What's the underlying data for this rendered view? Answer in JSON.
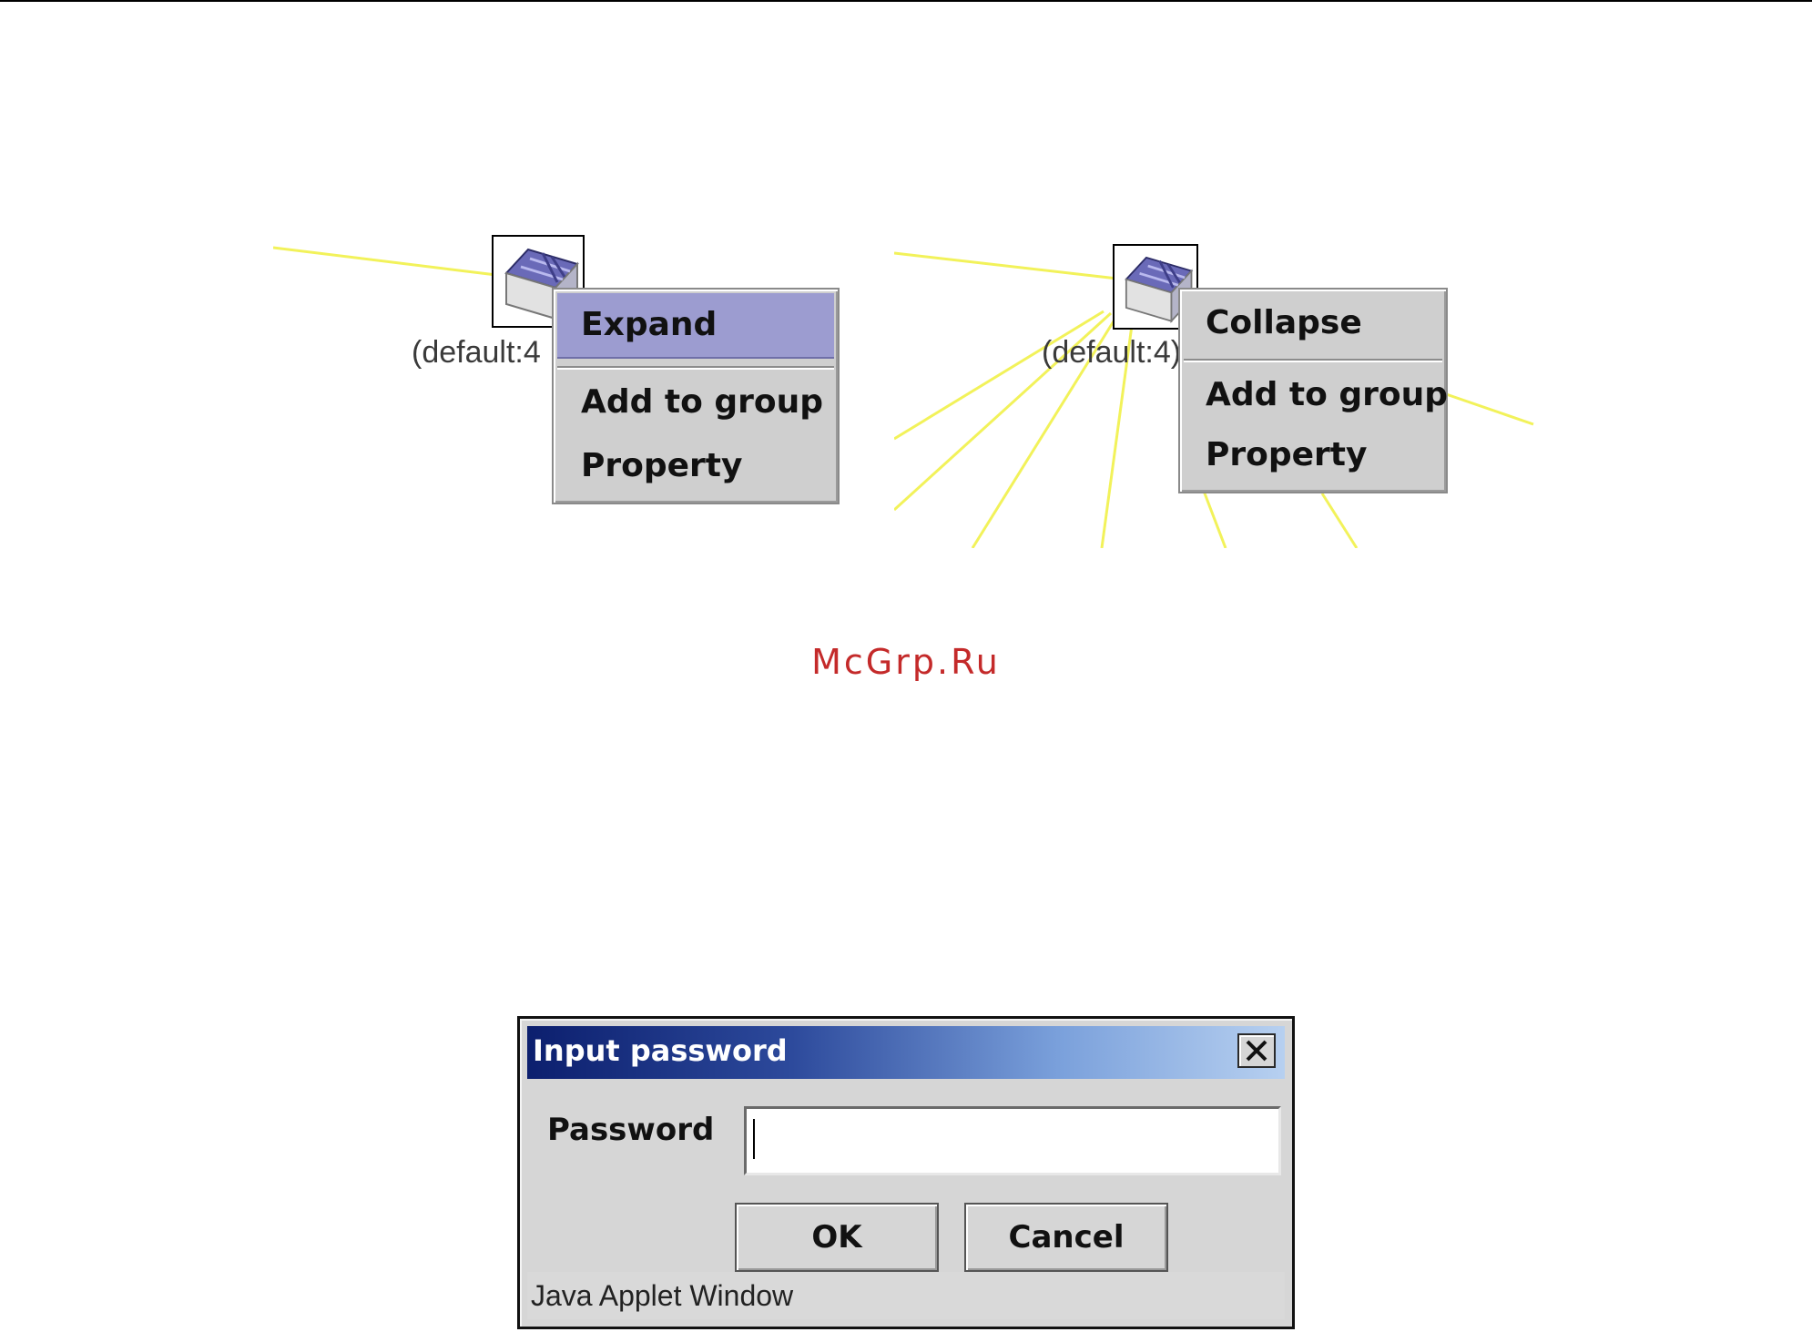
{
  "left_panel": {
    "node_label": "(default:4",
    "menu": {
      "items": [
        "Expand",
        "Add to group",
        "Property"
      ]
    }
  },
  "right_panel": {
    "node_label": "(default:4)",
    "menu": {
      "items": [
        "Collapse",
        "Add to group",
        "Property"
      ]
    }
  },
  "watermark": "McGrp.Ru",
  "dialog": {
    "title": "Input password",
    "close_icon": "close-x-icon",
    "password_label": "Password",
    "password_value": "",
    "ok_label": "OK",
    "cancel_label": "Cancel",
    "status": "Java Applet Window"
  },
  "colors": {
    "link_line": "#f2f25a",
    "menu_highlight": "#9c9cd0",
    "watermark": "#c42a2a",
    "titlebar_start": "#0c1f6e",
    "titlebar_end": "#b7d0f0"
  },
  "icons": [
    "switch-device-icon",
    "close-x-icon"
  ]
}
